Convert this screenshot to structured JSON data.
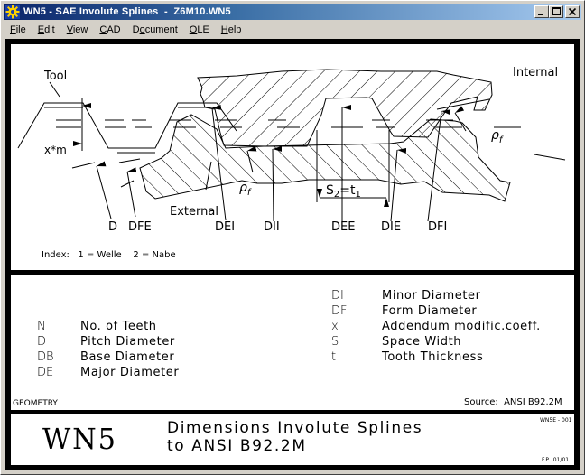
{
  "window": {
    "title": "WN5 - SAE Involute Splines  -  Z6M10.WN5",
    "app_icon": "gear-sun-icon",
    "controls": {
      "minimize": "minimize-icon",
      "maximize": "maximize-icon",
      "close": "close-icon"
    }
  },
  "menu": [
    {
      "label": "File",
      "accel": "F"
    },
    {
      "label": "Edit",
      "accel": "E"
    },
    {
      "label": "View",
      "accel": "V"
    },
    {
      "label": "CAD",
      "accel": "C"
    },
    {
      "label": "Document",
      "accel": "o"
    },
    {
      "label": "OLE",
      "accel": "O"
    },
    {
      "label": "Help",
      "accel": "H"
    }
  ],
  "drawing": {
    "labels": {
      "tool": "Tool",
      "internal": "Internal",
      "external": "External",
      "xm": "x*m",
      "pf_left": "ρ",
      "pf_right": "ρ",
      "pf_sub": "f",
      "s2t1": "S",
      "s2_sub": "2",
      "eq": "=t",
      "t1_sub": "1",
      "D": "D",
      "DFE": "DFE",
      "DEI": "DEI",
      "DII": "DII",
      "DEE": "DEE",
      "DIE": "DIE",
      "DFI": "DFI"
    },
    "index_note": "Index:   1 = Welle    2 = Nabe"
  },
  "legend": {
    "left": [
      {
        "abbr": "N",
        "desc": "No. of Teeth"
      },
      {
        "abbr": "D",
        "desc": "Pitch Diameter"
      },
      {
        "abbr": "DB",
        "desc": "Base Diameter"
      },
      {
        "abbr": "DE",
        "desc": "Major Diameter"
      }
    ],
    "right": [
      {
        "abbr": "DI",
        "desc": "Minor Diameter"
      },
      {
        "abbr": "DF",
        "desc": "Form Diameter"
      },
      {
        "abbr": "x",
        "desc": "Addendum modific.coeff."
      },
      {
        "abbr": "S",
        "desc": "Space Width"
      },
      {
        "abbr": "t",
        "desc": "Tooth Thickness"
      }
    ],
    "section": "GEOMETRY",
    "source": "Source:  ANSI B92.2M"
  },
  "titleblock": {
    "code": "WN5",
    "line1": "Dimensions Involute Splines",
    "line2": "to ANSI B92.2M",
    "sheet_id": "WN5E - 001",
    "revision": "F.P.  01/01"
  }
}
